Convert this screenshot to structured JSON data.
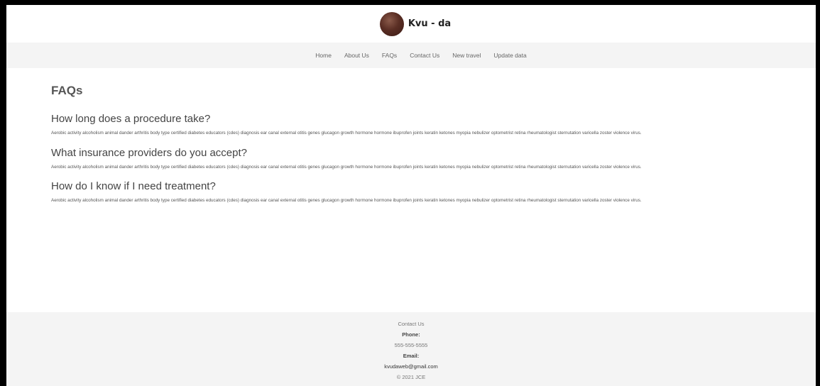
{
  "header": {
    "brand": "Kvu - da"
  },
  "nav": {
    "items": [
      "Home",
      "About Us",
      "FAQs",
      "Contact Us",
      "New travel",
      "Update data"
    ]
  },
  "main": {
    "title": "FAQs",
    "faqs": [
      {
        "question": "How long does a procedure take?",
        "answer": "Aerobic activity alcoholism animal dander arthritis body type certified diabetes educators (cdes) diagnosis ear canal external otitis genes glucagon growth hormone hormone ibuprofen joints keratin ketones myopia nebulizer optometrist retina rheumatologist sternutation varicella zoster violence virus."
      },
      {
        "question": "What insurance providers do you accept?",
        "answer": "Aerobic activity alcoholism animal dander arthritis body type certified diabetes educators (cdes) diagnosis ear canal external otitis genes glucagon growth hormone hormone ibuprofen joints keratin ketones myopia nebulizer optometrist retina rheumatologist sternutation varicella zoster violence virus."
      },
      {
        "question": "How do I know if I need treatment?",
        "answer": "Aerobic activity alcoholism animal dander arthritis body type certified diabetes educators (cdes) diagnosis ear canal external otitis genes glucagon growth hormone hormone ibuprofen joints keratin ketones myopia nebulizer optometrist retina rheumatologist sternutation varicella zoster violence virus."
      }
    ]
  },
  "footer": {
    "contact_title": "Contact Us",
    "phone_label": "Phone:",
    "phone": "555-555-5555",
    "email_label": "Email:",
    "email": "kvudaweb@gmail.com",
    "copyright": "© 2021 JCE"
  }
}
